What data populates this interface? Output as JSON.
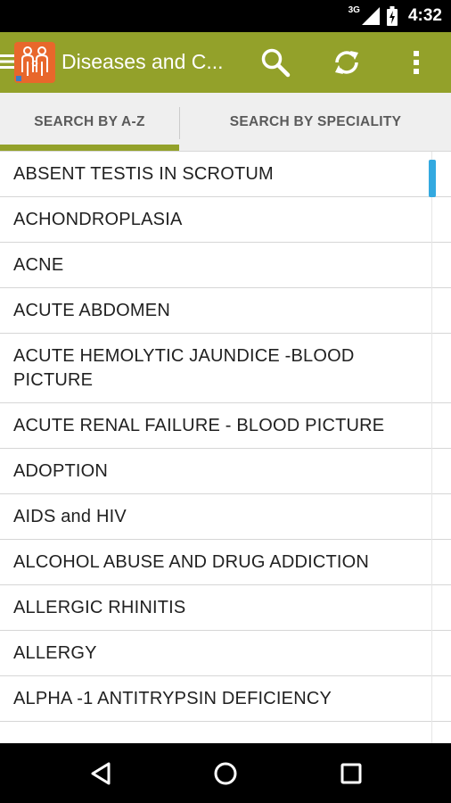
{
  "status_bar": {
    "network": "3G",
    "time": "4:32",
    "icons": [
      "signal-icon",
      "battery-icon"
    ]
  },
  "app_bar": {
    "title": "Diseases and C...",
    "accent_color": "#93a12a",
    "actions": [
      "search-icon",
      "refresh-icon",
      "overflow-menu-icon"
    ]
  },
  "tabs": [
    {
      "label": "SEARCH BY A-Z",
      "selected": true
    },
    {
      "label": "SEARCH BY SPECIALITY",
      "selected": false
    }
  ],
  "list": {
    "items": [
      "ABSENT TESTIS IN SCROTUM",
      "ACHONDROPLASIA",
      "ACNE",
      "ACUTE ABDOMEN",
      "ACUTE HEMOLYTIC JAUNDICE -BLOOD PICTURE",
      "ACUTE RENAL FAILURE - BLOOD PICTURE",
      "ADOPTION",
      "AIDS and HIV",
      "ALCOHOL ABUSE AND DRUG ADDICTION",
      "ALLERGIC RHINITIS",
      "ALLERGY",
      "ALPHA -1 ANTITRYPSIN DEFICIENCY"
    ]
  },
  "nav_bar": {
    "buttons": [
      "back-icon",
      "home-icon",
      "recents-icon"
    ]
  }
}
